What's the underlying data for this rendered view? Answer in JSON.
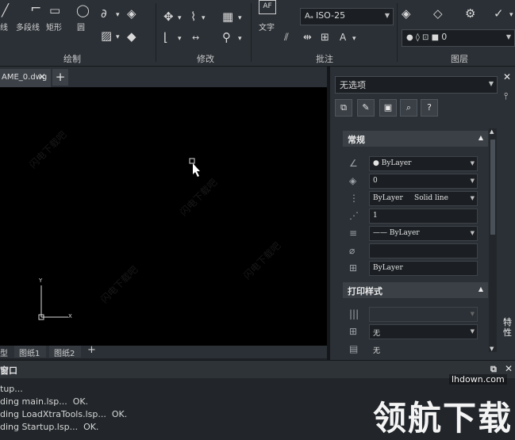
{
  "ribbon": {
    "draw_group": {
      "label": "绘制",
      "buttons": [
        "线",
        "多段线",
        "矩形",
        "圆"
      ]
    },
    "modify_group": {
      "label": "修改"
    },
    "annotate_group": {
      "label": "批注",
      "text_button": "文字",
      "dimstyle": "ISO-25"
    },
    "layer_group": {
      "label": "图层",
      "layer_combo": "0"
    }
  },
  "document": {
    "tab_name": "AME_0.dwg",
    "close_glyph": "✕",
    "new_tab_glyph": "+"
  },
  "layout_tabs": [
    "型",
    "图纸1",
    "图纸2",
    "+"
  ],
  "ucs": {
    "x_label": "X",
    "y_label": "Y"
  },
  "properties": {
    "selection": "无选项",
    "toolbar": [
      "⧉",
      "✎",
      "▣",
      "⌕",
      "?"
    ],
    "general_section": "常规",
    "rows": [
      {
        "icon": "pen-icon",
        "value": "● ByLayer",
        "dropdown": true
      },
      {
        "icon": "layer-icon",
        "value": "0",
        "dropdown": true
      },
      {
        "icon": "linetype-icon",
        "value": "ByLayer     Solid line",
        "dropdown": true
      },
      {
        "icon": "scale-icon",
        "value": "1",
        "dropdown": false
      },
      {
        "icon": "lineweight-icon",
        "value": "—— ByLayer",
        "dropdown": true
      },
      {
        "icon": "transparency-icon",
        "value": "",
        "dropdown": false
      },
      {
        "icon": "material-icon",
        "value": "ByLayer",
        "dropdown": false
      }
    ],
    "print_section": "打印样式",
    "print_rows": [
      {
        "icon": "print-style-icon",
        "value": "",
        "dropdown": true
      },
      {
        "icon": "table-icon",
        "value": "无",
        "dropdown": true
      },
      {
        "icon": "print-icon",
        "value": "无",
        "dropdown": false
      }
    ],
    "sidebar_label": "特性",
    "close_glyph": "✕"
  },
  "command_window": {
    "title": "窗口",
    "lines": [
      "tup...",
      "ding main.lsp...  OK.",
      "ding LoadXtraTools.lsp...  OK.",
      "ding Startup.lsp...  OK."
    ]
  },
  "watermark": {
    "site": "lhdown.com",
    "brand": "领航下载",
    "tile": "闪电下载吧"
  }
}
